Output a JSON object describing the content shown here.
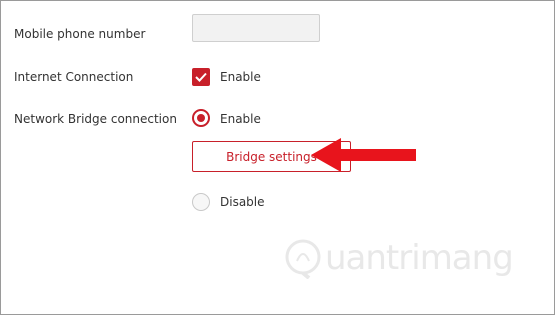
{
  "form": {
    "mobile_label": "Mobile phone number",
    "mobile_value": "",
    "internet_label": "Internet Connection",
    "internet_option": "Enable",
    "internet_checked": true,
    "bridge_label": "Network Bridge connection",
    "bridge_enable_label": "Enable",
    "bridge_settings_label": "Bridge settings",
    "bridge_disable_label": "Disable",
    "bridge_selected": "Enable"
  },
  "watermark": {
    "text": "uantrimang"
  },
  "colors": {
    "accent": "#c8202a",
    "arrow": "#e8141c"
  },
  "icons": {
    "annotation": "red-arrow-left-icon",
    "checkbox": "checkmark-icon",
    "logo": "quantrimang-logo-icon"
  }
}
